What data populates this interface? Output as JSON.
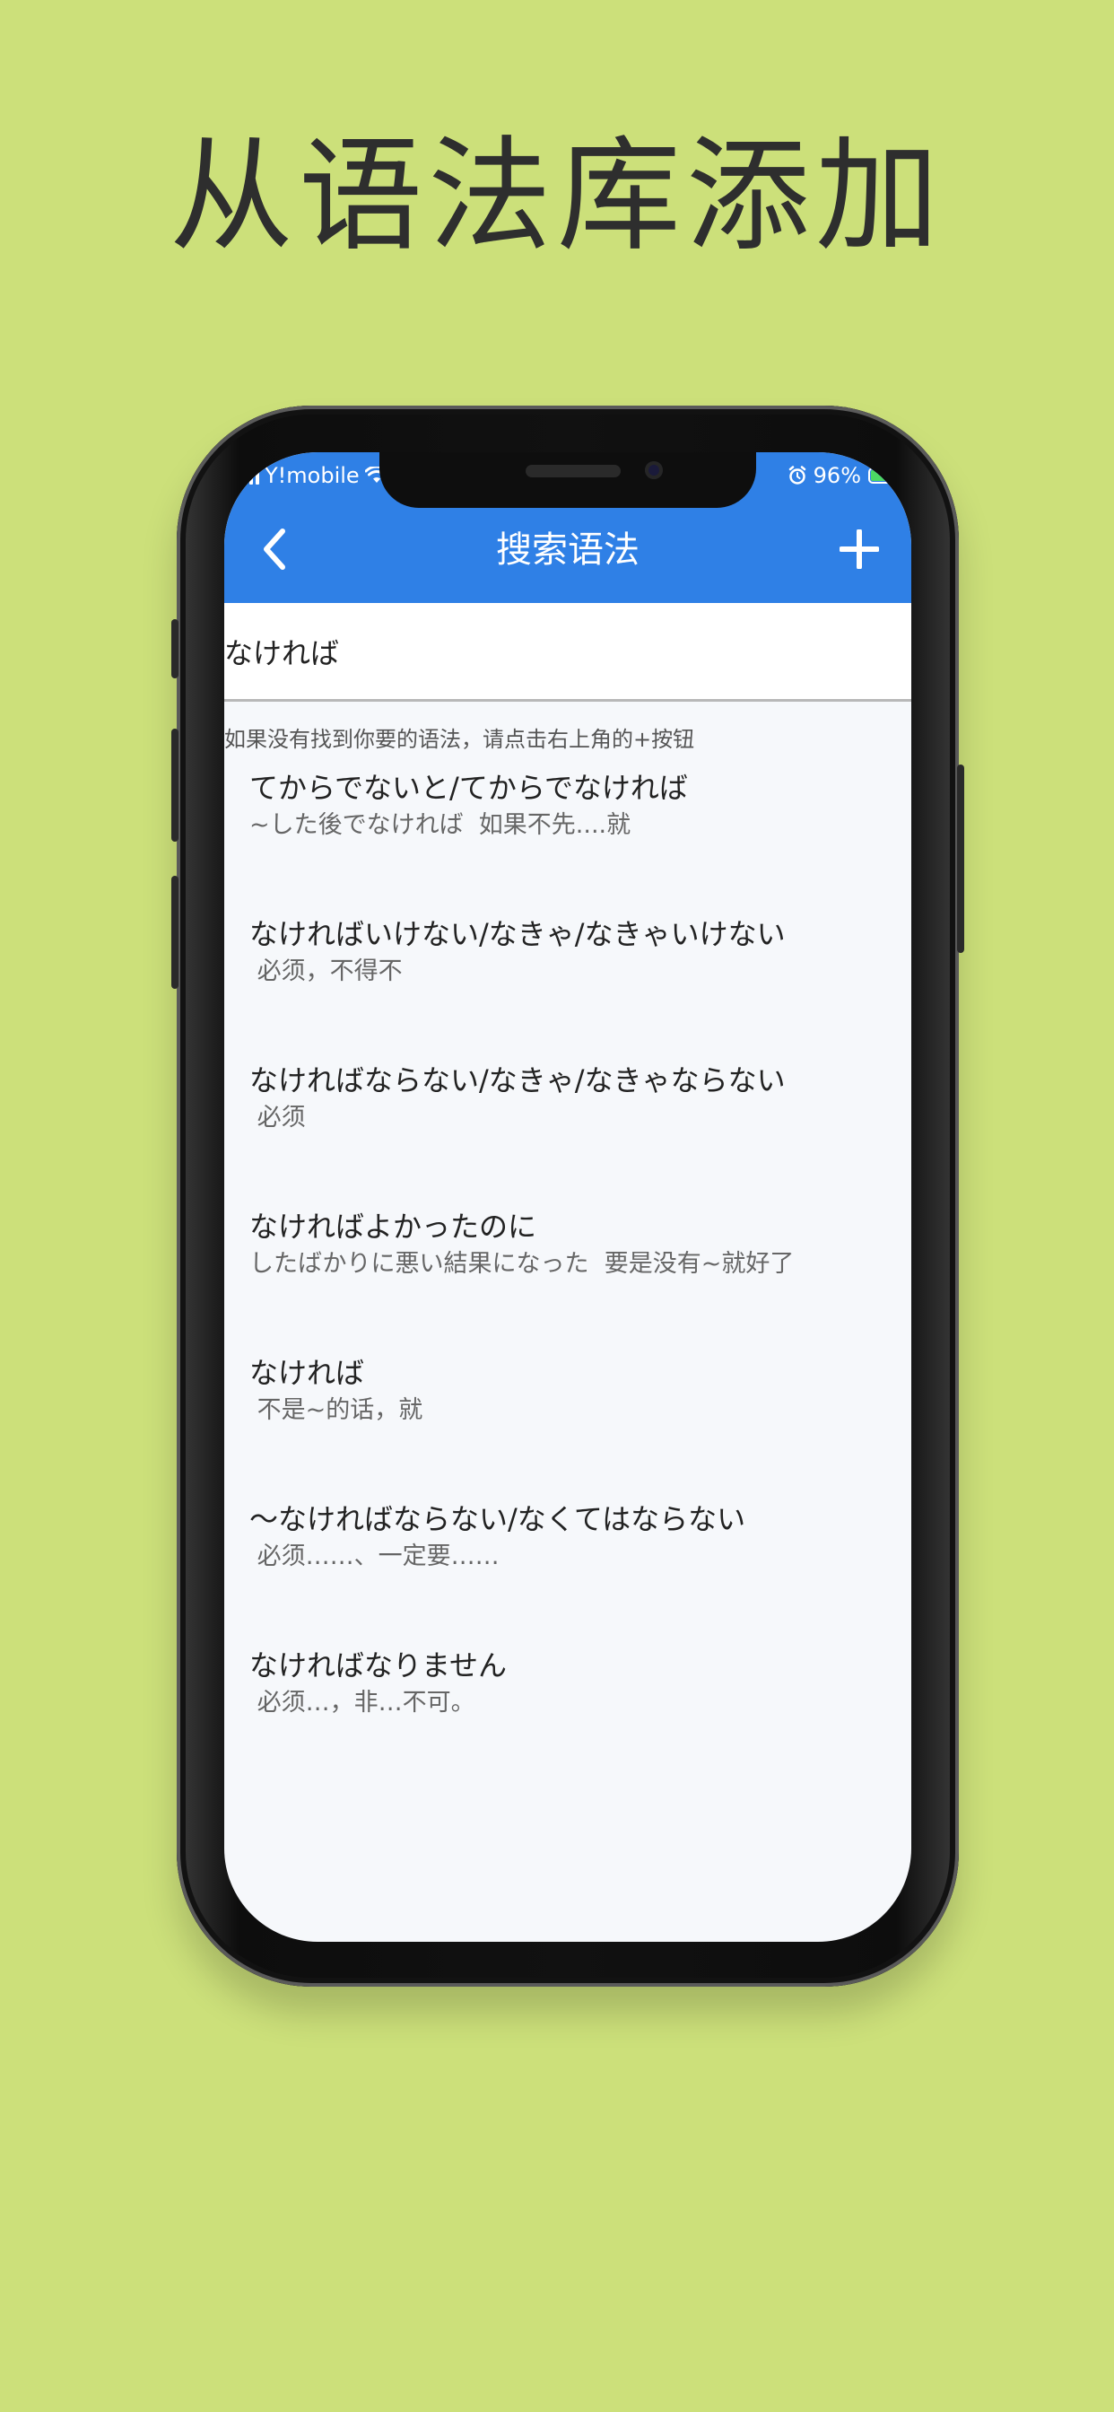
{
  "promo": {
    "title": "从语法库添加"
  },
  "status_bar": {
    "carrier": "Y!mobile",
    "battery_percent": "96%",
    "icons": [
      "signal-icon",
      "wifi-icon",
      "alarm-icon",
      "battery-icon"
    ]
  },
  "app_bar": {
    "title": "搜索语法",
    "back_icon": "chevron-left-icon",
    "add_icon": "plus-icon",
    "color": "#2f80e6"
  },
  "search": {
    "value": "なければ"
  },
  "hint": "如果没有找到你要的语法，请点击右上角的+按钮",
  "results": [
    {
      "title": "てからでないと/てからでなければ",
      "desc": "~した後でなければ  如果不先....就"
    },
    {
      "title": "なければいけない/なきゃ/なきゃいけない",
      "desc": " 必须，不得不"
    },
    {
      "title": "なければならない/なきゃ/なきゃならない",
      "desc": " 必须"
    },
    {
      "title": "なければよかったのに",
      "desc": "したばかりに悪い結果になった  要是没有~就好了"
    },
    {
      "title": "なければ",
      "desc": " 不是~的话，就"
    },
    {
      "title": "～なければならない/なくてはならない",
      "desc": " 必须……、一定要……"
    },
    {
      "title": "なければなりません",
      "desc": " 必须…，非…不可。"
    }
  ]
}
